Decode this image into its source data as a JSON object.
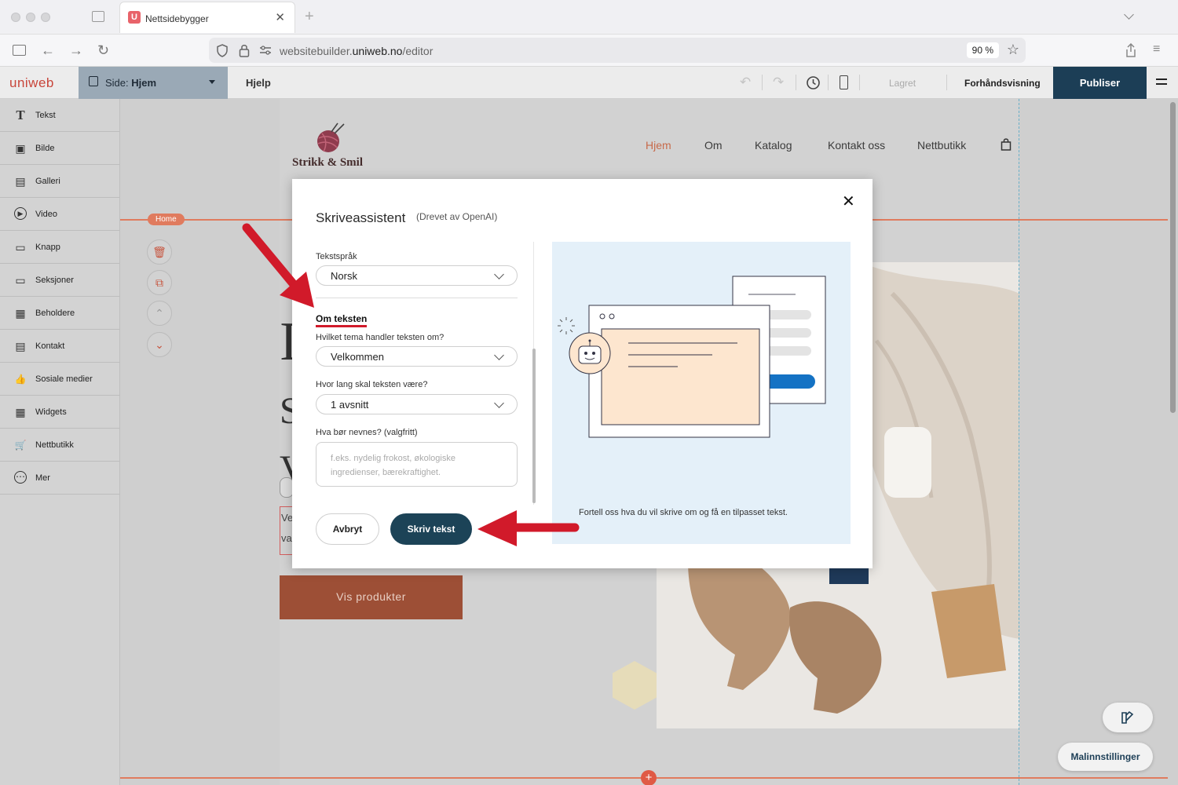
{
  "browser": {
    "tab_title": "Nettsidebygger",
    "favicon_letter": "U",
    "tab_close": "✕",
    "new_tab": "+",
    "url_prefix": "websitebuilder.",
    "url_domain": "uniweb.no",
    "url_path": "/editor",
    "zoom": "90 %"
  },
  "editor": {
    "logo": "uniweb",
    "page_label_prefix": "Side: ",
    "page_label": "Hjem",
    "help": "Hjelp",
    "saved": "Lagret",
    "preview": "Forhåndsvisning",
    "publish": "Publiser"
  },
  "sidebar": {
    "items": [
      {
        "label": "Tekst",
        "icon": "T"
      },
      {
        "label": "Bilde",
        "icon": "▣"
      },
      {
        "label": "Galleri",
        "icon": "▤"
      },
      {
        "label": "Video",
        "icon": "▶"
      },
      {
        "label": "Knapp",
        "icon": "▭"
      },
      {
        "label": "Seksjoner",
        "icon": "▭"
      },
      {
        "label": "Beholdere",
        "icon": "▦"
      },
      {
        "label": "Kontakt",
        "icon": "▤"
      },
      {
        "label": "Sosiale medier",
        "icon": "👍"
      },
      {
        "label": "Widgets",
        "icon": "▦"
      },
      {
        "label": "Nettbutikk",
        "icon": "🛒"
      },
      {
        "label": "Mer",
        "icon": "⋯"
      }
    ]
  },
  "site": {
    "brand": "Strikk & Smil",
    "nav": [
      "Hjem",
      "Om",
      "Katalog",
      "Kontakt oss",
      "Nettbutikk"
    ],
    "section_badge": "Home",
    "cta": "Vis produkter",
    "partial_text_1": "Ve",
    "partial_text_2": "va"
  },
  "dialog": {
    "title": "Skriveassistent",
    "subtitle": "(Drevet av OpenAI)",
    "close": "✕",
    "language_label": "Tekstspråk",
    "language_value": "Norsk",
    "section_heading": "Om teksten",
    "topic_label": "Hvilket tema handler teksten om?",
    "topic_value": "Velkommen",
    "length_label": "Hvor lang skal teksten være?",
    "length_value": "1 avsnitt",
    "mention_label": "Hva bør nevnes? (valgfritt)",
    "mention_placeholder": "f.eks. nydelig frokost, økologiske ingredienser, bærekraftighet.",
    "illustration_caption": "Fortell oss hva du vil skrive om og få en tilpasset tekst.",
    "cancel": "Avbryt",
    "submit": "Skriv tekst"
  },
  "footer": {
    "template_settings": "Malinnstillinger"
  },
  "colors": {
    "accent": "#c8453a",
    "publish_bg": "#1c3e56",
    "submit_bg": "#1c4357",
    "arrow": "#d11a2a",
    "cta_bg": "#9d4f36",
    "illustration_bg": "#e4f0f9"
  }
}
